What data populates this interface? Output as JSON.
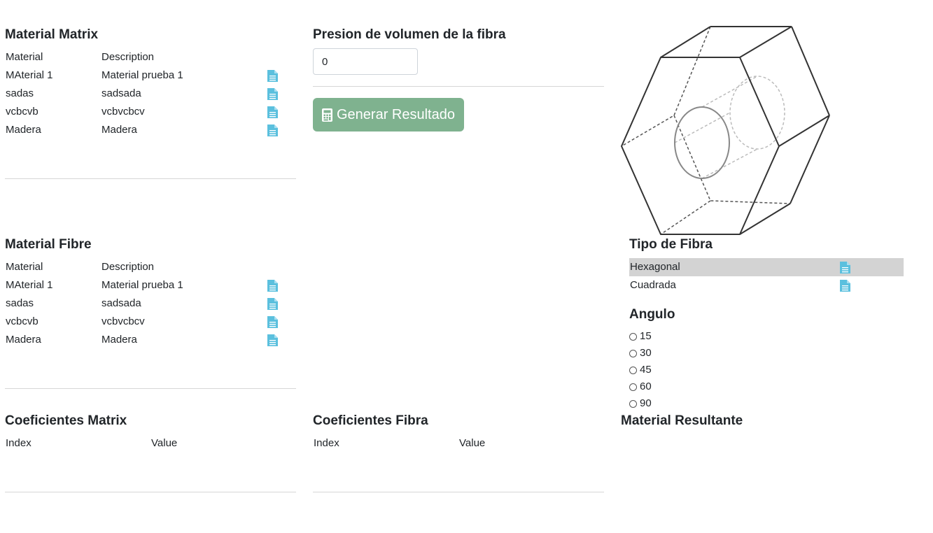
{
  "matrix": {
    "title": "Material Matrix",
    "col_material": "Material",
    "col_description": "Description",
    "rows": [
      {
        "material": "MAterial 1",
        "description": "Material prueba 1"
      },
      {
        "material": "sadas",
        "description": "sadsada"
      },
      {
        "material": "vcbcvb",
        "description": "vcbvcbcv"
      },
      {
        "material": "Madera",
        "description": "Madera"
      }
    ]
  },
  "fibre": {
    "title": "Material Fibre",
    "col_material": "Material",
    "col_description": "Description",
    "rows": [
      {
        "material": "MAterial 1",
        "description": "Material prueba 1"
      },
      {
        "material": "sadas",
        "description": "sadsada"
      },
      {
        "material": "vcbcvb",
        "description": "vcbvcbcv"
      },
      {
        "material": "Madera",
        "description": "Madera"
      }
    ]
  },
  "volume": {
    "title": "Presion de volumen de la fibra",
    "value": "0",
    "button_label": "Generar Resultado",
    "button_icon": "calculator-icon"
  },
  "fiber_type": {
    "title": "Tipo de Fibra",
    "options": [
      "Hexagonal",
      "Cuadrada"
    ],
    "selected": "Hexagonal"
  },
  "angle": {
    "title": "Angulo",
    "options": [
      "15",
      "30",
      "45",
      "60",
      "90"
    ]
  },
  "coef_matrix": {
    "title": "Coeficientes Matrix",
    "col_index": "Index",
    "col_value": "Value"
  },
  "coef_fibre": {
    "title": "Coeficientes Fibra",
    "col_index": "Index",
    "col_value": "Value"
  },
  "result": {
    "title": "Material Resultante"
  },
  "colors": {
    "doc_icon": "#5bc0de",
    "button": "#7fb28f",
    "selected_row": "#d3d3d3"
  }
}
